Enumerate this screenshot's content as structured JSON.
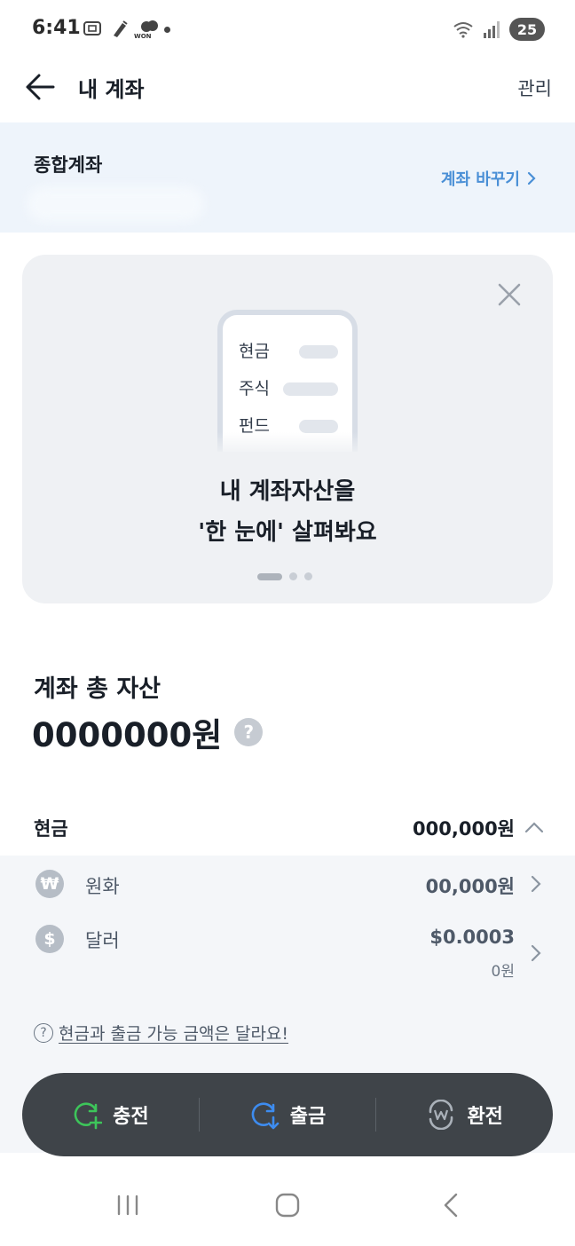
{
  "status_bar": {
    "time": "6:41",
    "won_label": "WON",
    "network": "5",
    "battery": "25"
  },
  "header": {
    "title": "내 계좌",
    "manage_label": "관리"
  },
  "account": {
    "type": "종합계좌",
    "change_label": "계좌 바꾸기"
  },
  "promo": {
    "illustration_items": [
      "현금",
      "주식",
      "펀드"
    ],
    "line1": "내 계좌자산을",
    "line2": "'한 눈에' 살펴봐요",
    "page_count": 3,
    "active_page": 1
  },
  "total_assets": {
    "label": "계좌 총 자산",
    "amount": "0000000원",
    "help": "?"
  },
  "cash": {
    "label": "현금",
    "amount": "000,000원",
    "items": [
      {
        "icon": "₩",
        "name": "원화",
        "amount": "00,000원",
        "sub": ""
      },
      {
        "icon": "$",
        "name": "달러",
        "amount": "$0.0003",
        "sub": "0원"
      }
    ],
    "notice": "현금과 출금 가능 금액은 달라요!"
  },
  "actions": [
    {
      "label": "충전",
      "icon": "charge-icon",
      "color": "#3dc55a"
    },
    {
      "label": "출금",
      "icon": "withdraw-icon",
      "color": "#3d8cf0"
    },
    {
      "label": "환전",
      "icon": "exchange-icon",
      "color": "#aab1b9"
    }
  ]
}
